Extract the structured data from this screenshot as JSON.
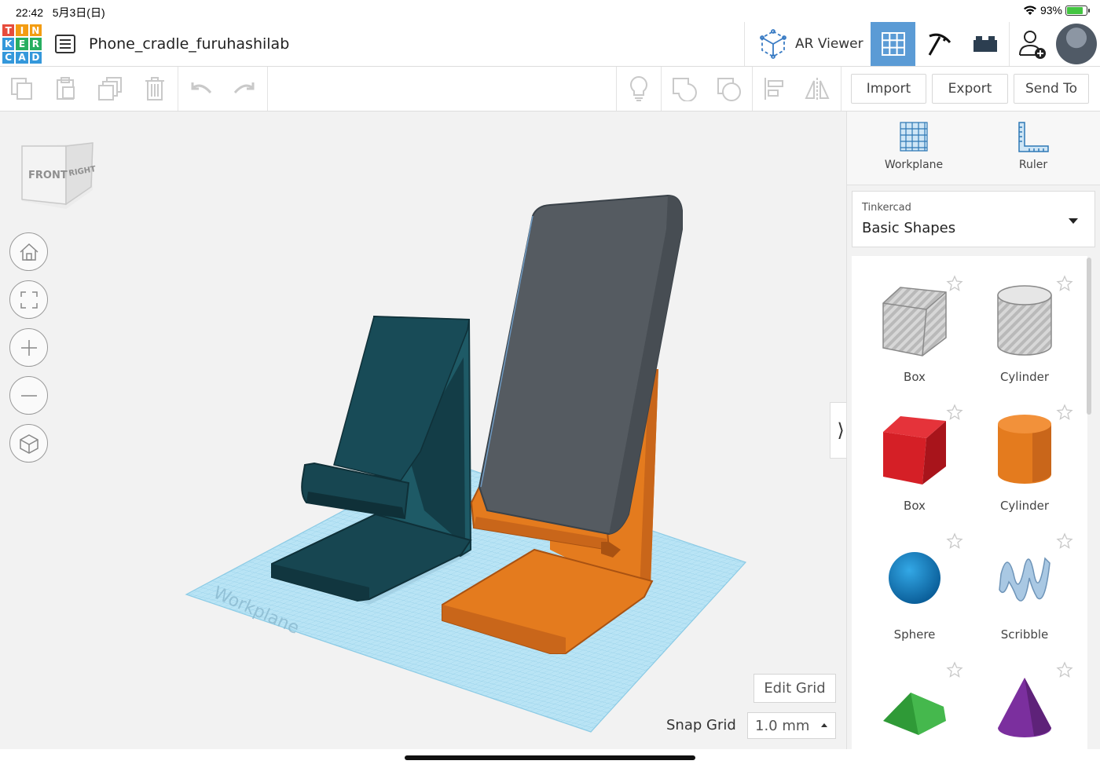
{
  "status_bar": {
    "time": "22:42",
    "date": "5月3日(日)",
    "battery": "93%"
  },
  "logo": {
    "letters": [
      "T",
      "I",
      "N",
      "K",
      "E",
      "R",
      "C",
      "A",
      "D"
    ]
  },
  "header": {
    "title": "Phone_cradle_furuhashilab",
    "ar_viewer_label": "AR Viewer"
  },
  "toolbar": {
    "import_label": "Import",
    "export_label": "Export",
    "send_label": "Send To"
  },
  "viewcube": {
    "front": "FRONT",
    "right": "RIGHT"
  },
  "workplane_text": "Workplane",
  "panel": {
    "workplane_label": "Workplane",
    "ruler_label": "Ruler",
    "library_owner": "Tinkercad",
    "library_name": "Basic Shapes",
    "shapes": [
      {
        "label": "Box",
        "icon": "box-hole-icon"
      },
      {
        "label": "Cylinder",
        "icon": "cylinder-hole-icon"
      },
      {
        "label": "Box",
        "icon": "box-icon"
      },
      {
        "label": "Cylinder",
        "icon": "cylinder-icon"
      },
      {
        "label": "Sphere",
        "icon": "sphere-icon"
      },
      {
        "label": "Scribble",
        "icon": "scribble-icon"
      },
      {
        "label": "",
        "icon": "roof-icon"
      },
      {
        "label": "",
        "icon": "cone-icon"
      }
    ]
  },
  "grid": {
    "edit_grid_label": "Edit Grid",
    "snap_grid_label": "Snap Grid",
    "snap_value": "1.0 mm"
  },
  "colors": {
    "teal_cradle": "#174651",
    "orange_cradle": "#e47b1e",
    "phone": "#545a60",
    "workplane": "#a9dcf1",
    "active_button": "#5b9bd5"
  }
}
